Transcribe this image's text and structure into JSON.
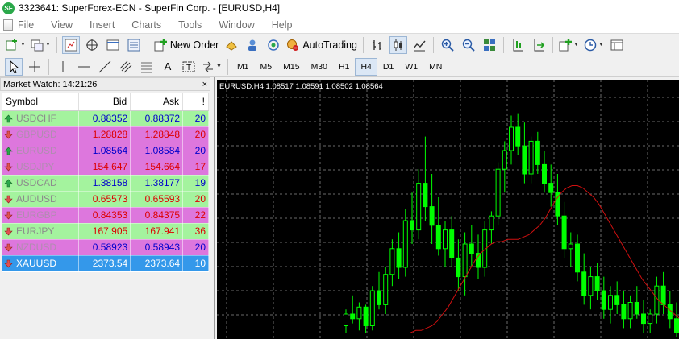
{
  "window": {
    "title": "3323641: SuperForex-ECN - SuperFin Corp. - [EURUSD,H4]",
    "logo_text": "SF"
  },
  "menu": {
    "items": [
      "File",
      "View",
      "Insert",
      "Charts",
      "Tools",
      "Window",
      "Help"
    ]
  },
  "toolbar": {
    "new_order_label": "New Order",
    "autotrading_label": "AutoTrading"
  },
  "timeframes": {
    "items": [
      "M1",
      "M5",
      "M15",
      "M30",
      "H1",
      "H4",
      "D1",
      "W1",
      "MN"
    ],
    "active": "H4"
  },
  "market_watch": {
    "header": "Market Watch: 14:21:26",
    "close_glyph": "×",
    "columns": {
      "symbol": "Symbol",
      "bid": "Bid",
      "ask": "Ask",
      "spread": "!"
    },
    "rows": [
      {
        "symbol": "USDCHF",
        "bid": "0.88352",
        "ask": "0.88372",
        "spread": "20",
        "direction": "up",
        "bg": "green",
        "price_color": "#0000cc",
        "symbol_color": "#8c8c8c"
      },
      {
        "symbol": "GBPUSD",
        "bid": "1.28828",
        "ask": "1.28848",
        "spread": "20",
        "direction": "down",
        "bg": "magenta",
        "price_color": "#dd0000",
        "symbol_color": "#b08cb0"
      },
      {
        "symbol": "EURUSD",
        "bid": "1.08564",
        "ask": "1.08584",
        "spread": "20",
        "direction": "up",
        "bg": "magenta",
        "price_color": "#0000cc",
        "symbol_color": "#b08cb0"
      },
      {
        "symbol": "USDJPY",
        "bid": "154.647",
        "ask": "154.664",
        "spread": "17",
        "direction": "down",
        "bg": "magenta",
        "price_color": "#dd0000",
        "symbol_color": "#b08cb0"
      },
      {
        "symbol": "USDCAD",
        "bid": "1.38158",
        "ask": "1.38177",
        "spread": "19",
        "direction": "up",
        "bg": "green",
        "price_color": "#0000cc",
        "symbol_color": "#8c8c8c"
      },
      {
        "symbol": "AUDUSD",
        "bid": "0.65573",
        "ask": "0.65593",
        "spread": "20",
        "direction": "down",
        "bg": "green",
        "price_color": "#dd0000",
        "symbol_color": "#8c8c8c"
      },
      {
        "symbol": "EURGBP",
        "bid": "0.84353",
        "ask": "0.84375",
        "spread": "22",
        "direction": "down",
        "bg": "magenta",
        "price_color": "#dd0000",
        "symbol_color": "#b08cb0"
      },
      {
        "symbol": "EURJPY",
        "bid": "167.905",
        "ask": "167.941",
        "spread": "36",
        "direction": "down",
        "bg": "green",
        "price_color": "#dd0000",
        "symbol_color": "#8c8c8c"
      },
      {
        "symbol": "NZDUSD",
        "bid": "0.58923",
        "ask": "0.58943",
        "spread": "20",
        "direction": "down",
        "bg": "magenta",
        "price_color": "#0000cc",
        "symbol_color": "#b08cb0"
      },
      {
        "symbol": "XAUUSD",
        "bid": "2373.54",
        "ask": "2373.64",
        "spread": "10",
        "direction": "down",
        "bg": "blue",
        "price_color": "#ffffff",
        "symbol_color": "#ffffff"
      }
    ]
  },
  "chart": {
    "header": "EURUSD,H4  1.08517 1.08591 1.08502 1.08564",
    "background": "#000000",
    "candle_color": "#00ff00",
    "ma_color": "#d01010",
    "grid_color": "#6a6a6a"
  },
  "chart_data": {
    "type": "candlestick",
    "symbol": "EURUSD",
    "timeframe": "H4",
    "grid": true,
    "last_bar": {
      "open": 1.08517,
      "high": 1.08591,
      "low": 1.08502,
      "close": 1.08564
    },
    "candles": [
      [
        0.05,
        0.12,
        0.02,
        0.1
      ],
      [
        0.1,
        0.18,
        0.06,
        0.08
      ],
      [
        0.08,
        0.15,
        0.03,
        0.13
      ],
      [
        0.13,
        0.14,
        0.02,
        0.05
      ],
      [
        0.05,
        0.22,
        0.03,
        0.2
      ],
      [
        0.2,
        0.28,
        0.12,
        0.14
      ],
      [
        0.14,
        0.3,
        0.1,
        0.27
      ],
      [
        0.27,
        0.42,
        0.22,
        0.38
      ],
      [
        0.38,
        0.45,
        0.25,
        0.3
      ],
      [
        0.3,
        0.55,
        0.26,
        0.5
      ],
      [
        0.5,
        0.62,
        0.4,
        0.46
      ],
      [
        0.46,
        0.72,
        0.42,
        0.66
      ],
      [
        0.66,
        0.86,
        0.5,
        0.56
      ],
      [
        0.56,
        0.7,
        0.4,
        0.48
      ],
      [
        0.48,
        0.6,
        0.35,
        0.38
      ],
      [
        0.38,
        0.5,
        0.3,
        0.46
      ],
      [
        0.46,
        0.52,
        0.3,
        0.34
      ],
      [
        0.34,
        0.42,
        0.2,
        0.26
      ],
      [
        0.26,
        0.45,
        0.18,
        0.4
      ],
      [
        0.4,
        0.48,
        0.3,
        0.36
      ],
      [
        0.36,
        0.44,
        0.25,
        0.3
      ],
      [
        0.3,
        0.5,
        0.26,
        0.46
      ],
      [
        0.46,
        0.54,
        0.4,
        0.52
      ],
      [
        0.52,
        0.75,
        0.48,
        0.72
      ],
      [
        0.72,
        0.84,
        0.62,
        0.8
      ],
      [
        0.8,
        0.95,
        0.74,
        0.9
      ],
      [
        0.9,
        0.96,
        0.78,
        0.82
      ],
      [
        0.82,
        0.92,
        0.66,
        0.7
      ],
      [
        0.7,
        0.86,
        0.66,
        0.84
      ],
      [
        0.84,
        0.88,
        0.7,
        0.74
      ],
      [
        0.74,
        0.8,
        0.62,
        0.66
      ],
      [
        0.66,
        0.74,
        0.56,
        0.62
      ],
      [
        0.62,
        0.7,
        0.48,
        0.52
      ],
      [
        0.52,
        0.58,
        0.34,
        0.38
      ],
      [
        0.38,
        0.45,
        0.3,
        0.4
      ],
      [
        0.4,
        0.44,
        0.24,
        0.28
      ],
      [
        0.28,
        0.36,
        0.14,
        0.18
      ],
      [
        0.18,
        0.3,
        0.12,
        0.26
      ],
      [
        0.26,
        0.32,
        0.16,
        0.2
      ],
      [
        0.2,
        0.26,
        0.08,
        0.12
      ],
      [
        0.12,
        0.22,
        0.06,
        0.18
      ],
      [
        0.18,
        0.24,
        0.1,
        0.14
      ],
      [
        0.14,
        0.2,
        0.04,
        0.08
      ],
      [
        0.08,
        0.18,
        0.04,
        0.15
      ],
      [
        0.15,
        0.22,
        0.08,
        0.1
      ],
      [
        0.1,
        0.16,
        0.02,
        0.06
      ],
      [
        0.06,
        0.12,
        0.02,
        0.1
      ],
      [
        0.1,
        0.26,
        0.06,
        0.22
      ],
      [
        0.22,
        0.28,
        0.1,
        0.14
      ],
      [
        0.14,
        0.2,
        0.04,
        0.08
      ],
      [
        0.08,
        0.15,
        0.0,
        0.02
      ]
    ],
    "ma": [
      0.02,
      0.03,
      0.03,
      0.04,
      0.05,
      0.07,
      0.1,
      0.13,
      0.17,
      0.21,
      0.25,
      0.29,
      0.33,
      0.36,
      0.38,
      0.4,
      0.41,
      0.41,
      0.42,
      0.42,
      0.42,
      0.43,
      0.44,
      0.46,
      0.48,
      0.51,
      0.55,
      0.59,
      0.62,
      0.64,
      0.65,
      0.65,
      0.64,
      0.62,
      0.6,
      0.57,
      0.53,
      0.49,
      0.45,
      0.41,
      0.37,
      0.33,
      0.29,
      0.25,
      0.22,
      0.19,
      0.16,
      0.14,
      0.12,
      0.1,
      0.08
    ],
    "ma_start_index": 14
  }
}
